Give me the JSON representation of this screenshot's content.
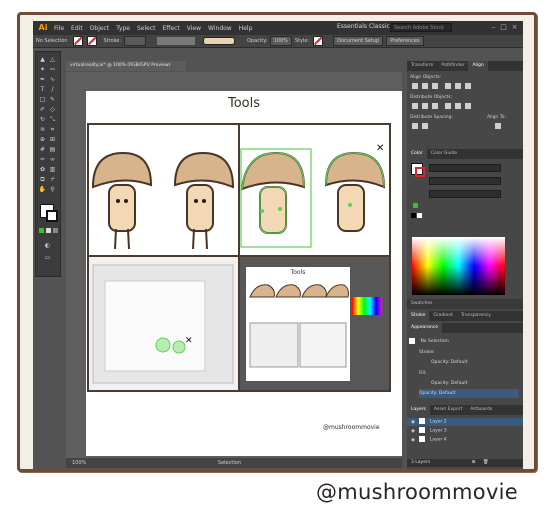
{
  "app": {
    "logo": "Ai",
    "menu": [
      "File",
      "Edit",
      "Object",
      "Type",
      "Select",
      "Effect",
      "View",
      "Window",
      "Help"
    ],
    "workspace": "Essentials Classic",
    "search_placeholder": "Search Adobe Stock"
  },
  "control_bar": {
    "selection": "No Selection",
    "stroke_label": "Stroke:",
    "opacity_label": "Opacity:",
    "opacity_value": "100%",
    "style_label": "Style:",
    "document_setup": "Document Setup",
    "preferences": "Preferences"
  },
  "document": {
    "tab_title": "virtualreality.ai* @ 100% (RGB/GPU Preview)"
  },
  "artboard": {
    "title": "Tools",
    "signature": "@mushroommovie",
    "nested_title": "Tools"
  },
  "status": {
    "zoom": "100%",
    "mode": "Selection"
  },
  "panels": {
    "top_tabs": [
      "Transform",
      "Pathfinder",
      "Align"
    ],
    "align_objects": "Align Objects:",
    "distribute_objects": "Distribute Objects:",
    "distribute_spacing": "Distribute Spacing:",
    "align_to": "Align To:",
    "color_tabs": [
      "Color",
      "Color Guide"
    ],
    "swatches": "Swatches",
    "stroke_tabs": [
      "Stroke",
      "Gradient",
      "Transparency"
    ],
    "appearance_title": "Appearance",
    "appearance": {
      "no_selection": "No Selection",
      "stroke": "Stroke:",
      "opacity1": "Opacity: Default",
      "fill": "Fill:",
      "opacity2": "Opacity: Default",
      "opacity3": "Opacity: Default"
    },
    "layers_tabs": [
      "Layers",
      "Asset Export",
      "Artboards"
    ],
    "layers": [
      "Layer 2",
      "Layer 3",
      "Layer 4"
    ],
    "layers_count": "3 Layers"
  },
  "caption": "@mushroommovie",
  "colors": {
    "frame_border": "#6d4c39",
    "mushroom_cap": "#d8b48c",
    "mushroom_body": "#f2d8b5",
    "selection_green": "#5fcf5a",
    "layer_blue": "#3a8ee6"
  }
}
